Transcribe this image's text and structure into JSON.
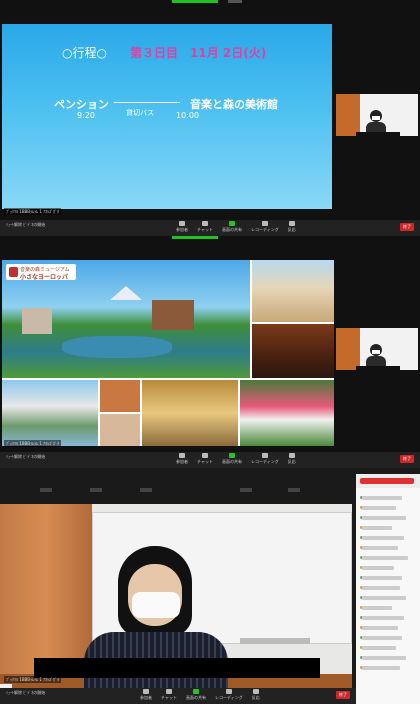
{
  "panel1": {
    "slide": {
      "line1_label": "○行程○",
      "line1_day": "第３日目　11月 2日(火)",
      "from_place": "ペンション",
      "from_time": "9:20",
      "transport": "貸切バス",
      "to_place": "音楽と森の美術館",
      "to_time": "10:00"
    },
    "caption": "ﾌﾞｯｸﾏﾙ 1BBBﾗﾑﾗﾑ 1 ﾅｵｼｽﾞｶﾞﾀ"
  },
  "panel2": {
    "logo_line1": "音楽の森ミュージアム",
    "logo_line2": "小さなヨーロッパ",
    "caption": "ﾌﾞｯｸﾏﾙ 1BBBﾗﾑﾗﾑ 1 ﾅｵｼｽﾞｶﾞﾀ"
  },
  "panel3": {
    "caption": "ﾌﾞｯｸﾏﾙ 1BBBﾗﾑﾗﾑ 1 ﾅｵｼｽﾞｶﾞﾀ"
  },
  "controls": {
    "left_lines": [
      "ﾐｭｰﾄ解除",
      "ﾋﾞﾃﾞｵの開始"
    ],
    "items": [
      "参加者",
      "チャット",
      "画面の共有",
      "レコーディング",
      "反応"
    ],
    "end": "終了"
  },
  "colors": {
    "accent_pink": "#e040a0",
    "end_red": "#d02828",
    "green": "#20c020"
  }
}
